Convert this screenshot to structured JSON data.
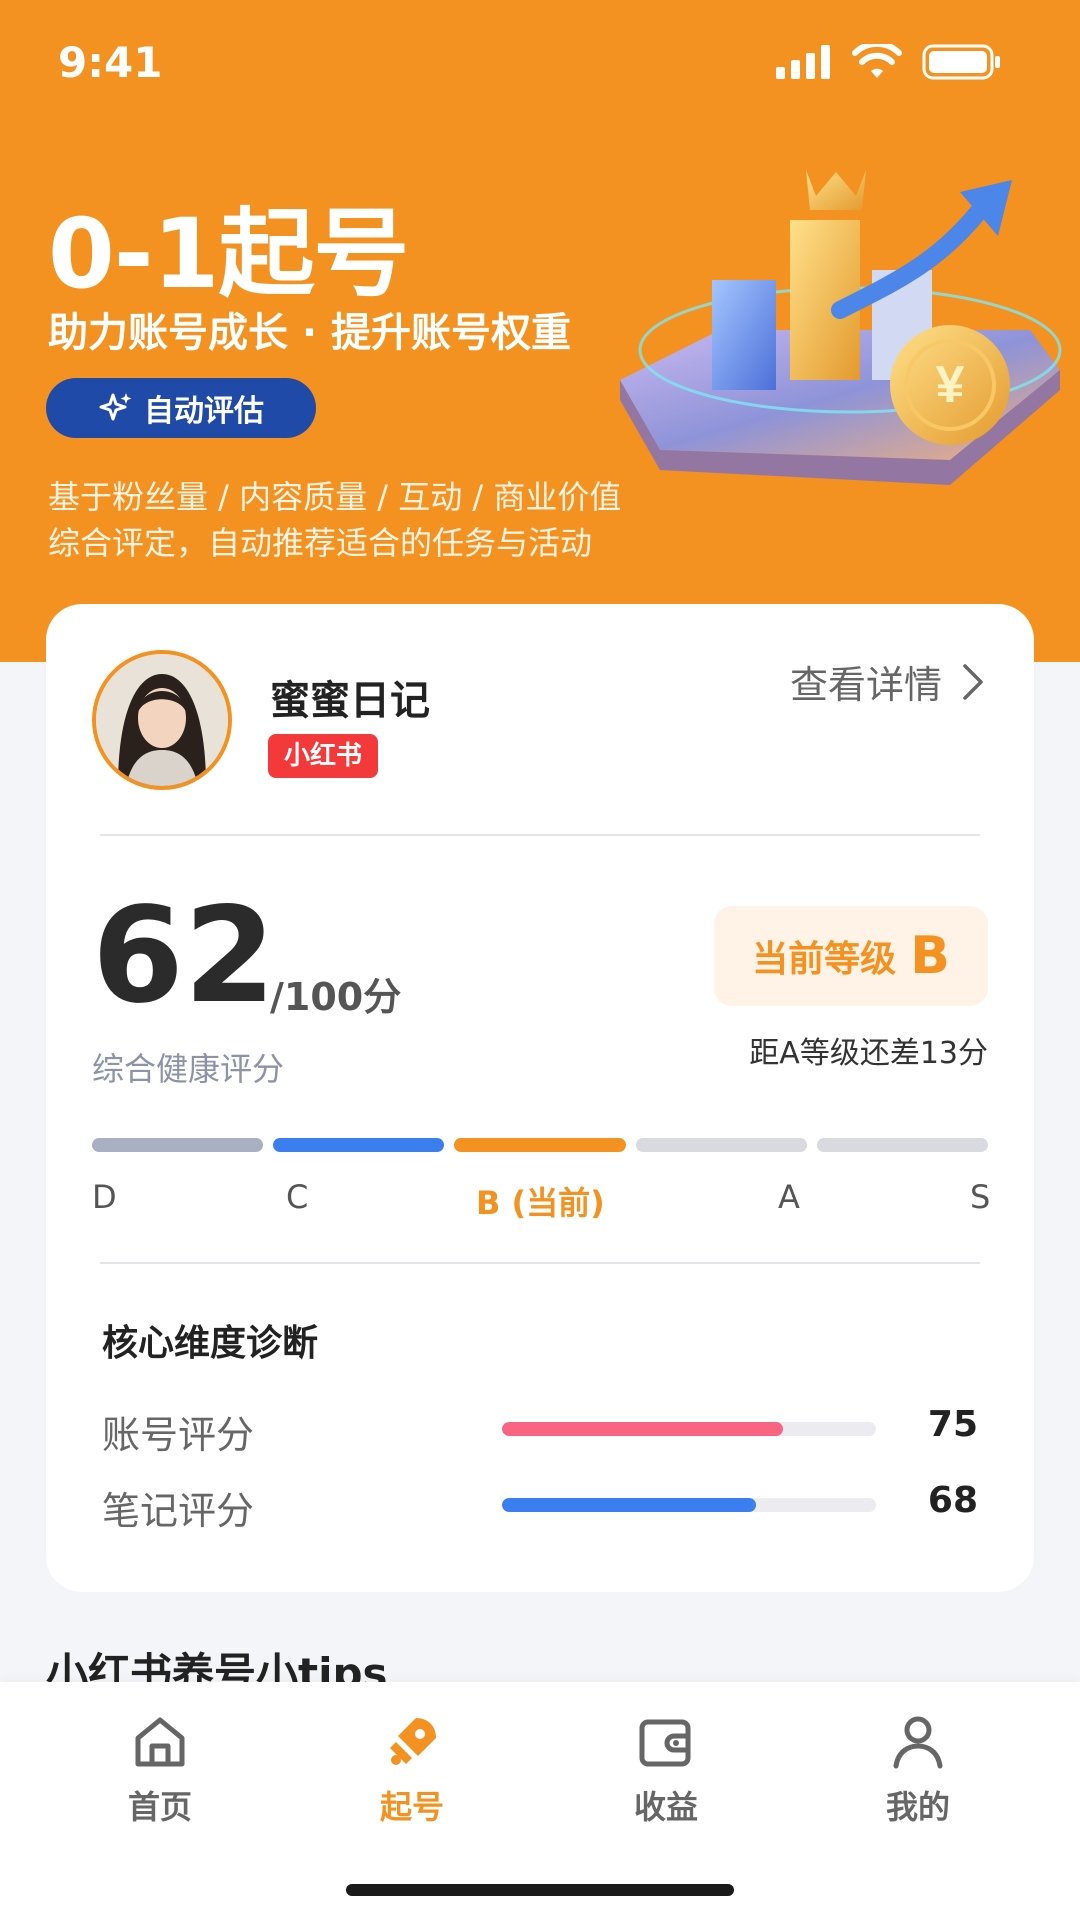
{
  "status": {
    "time": "9:41"
  },
  "hero": {
    "title": "0-1起号",
    "subtitle": "助力账号成长 · 提升账号权重",
    "badge_label": "自动评估",
    "desc_line1": "基于粉丝量 / 内容质量 / 互动 / 商业价值",
    "desc_line2": "综合评定，自动推荐适合的任务与活动",
    "currency_symbol": "¥"
  },
  "account": {
    "name": "蜜蜜日记",
    "platform": "小红书",
    "detail_link": "查看详情"
  },
  "score": {
    "value": "62",
    "suffix": "/100分",
    "label": "综合健康评分",
    "level_label": "当前等级",
    "level_value": "B",
    "gap_text": "距A等级还差13分"
  },
  "grades": [
    {
      "label": "D",
      "color": "#a9b0c2"
    },
    {
      "label": "C",
      "color": "#3b7ef0"
    },
    {
      "label": "B (当前)",
      "color": "#f39220"
    },
    {
      "label": "A",
      "color": "#d8dadf"
    },
    {
      "label": "S",
      "color": "#d8dadf"
    }
  ],
  "diagnosis": {
    "title": "核心维度诊断",
    "items": [
      {
        "name": "账号评分",
        "value": "75",
        "fraction": 0.75,
        "color": "#f86481"
      },
      {
        "name": "笔记评分",
        "value": "68",
        "fraction": 0.68,
        "color": "#3b7ef0"
      }
    ]
  },
  "tips_title": "小红书养号小tips",
  "tabs": [
    {
      "label": "首页",
      "icon": "home-icon",
      "active": false
    },
    {
      "label": "起号",
      "icon": "rocket-icon",
      "active": true
    },
    {
      "label": "收益",
      "icon": "wallet-icon",
      "active": false
    },
    {
      "label": "我的",
      "icon": "user-icon",
      "active": false
    }
  ],
  "colors": {
    "brand": "#f39220",
    "badge": "#1f4aa8",
    "tag": "#f4393b"
  }
}
